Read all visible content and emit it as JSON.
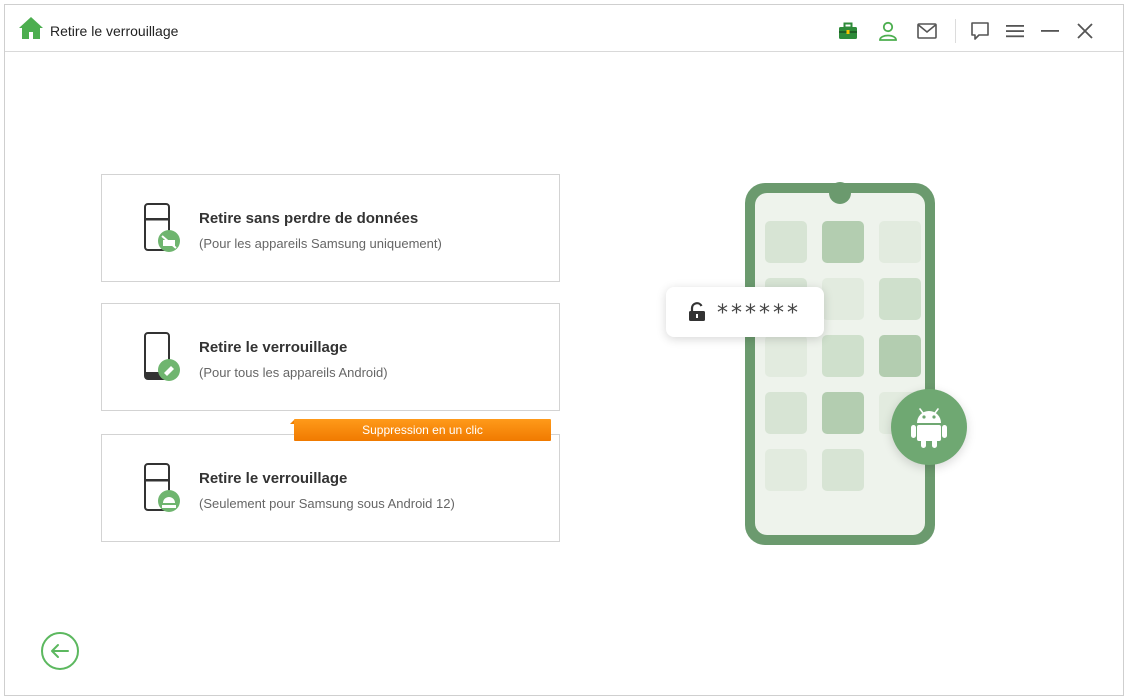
{
  "window": {
    "title": "Retire le verrouillage"
  },
  "toolbar": {
    "icons": [
      "toolbox-icon",
      "account-icon",
      "mail-icon",
      "feedback-icon",
      "menu-icon",
      "minimize-icon",
      "close-icon"
    ]
  },
  "options": [
    {
      "title": "Retire sans perdre de données",
      "subtitle": "(Pour les appareils Samsung uniquement)",
      "icon": "samsung-phone-icon"
    },
    {
      "title": "Retire le verrouillage",
      "subtitle": "(Pour tous les appareils Android)",
      "icon": "android-phone-erase-icon"
    },
    {
      "title": "Retire le verrouillage",
      "subtitle": "(Seulement pour Samsung sous Android 12)",
      "icon": "samsung-android12-phone-icon",
      "badge": "Suppression en un clic"
    }
  ],
  "illustration": {
    "password_mask": "******"
  },
  "colors": {
    "accent": "#5cb85f",
    "phone_frame": "#6b9a6e",
    "badge": "#f58a00"
  }
}
